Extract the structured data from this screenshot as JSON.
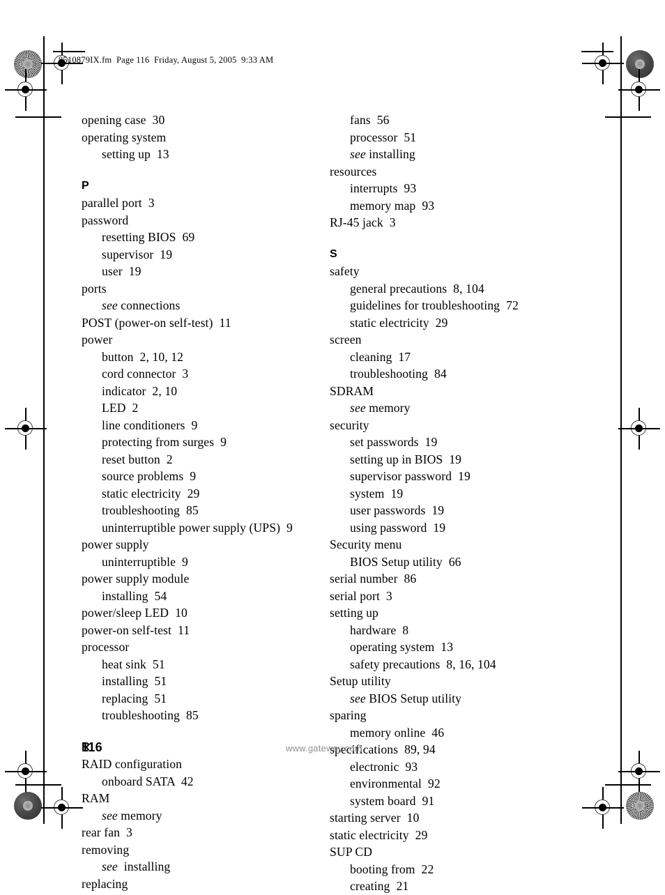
{
  "header": {
    "slug": "8510879IX.fm  Page 116  Friday, August 5, 2005  9:33 AM"
  },
  "footer": {
    "page_number": "116",
    "website": "www.gateway.com"
  },
  "index": {
    "left_column": [
      {
        "level": 0,
        "text": "opening case  30"
      },
      {
        "level": 0,
        "text": "operating system"
      },
      {
        "level": 1,
        "text": "setting up  13"
      },
      {
        "level": 0,
        "type": "letter",
        "text": "P",
        "space_before": true
      },
      {
        "level": 0,
        "text": "parallel port  3"
      },
      {
        "level": 0,
        "text": "password"
      },
      {
        "level": 1,
        "text": "resetting BIOS  69"
      },
      {
        "level": 1,
        "text": "supervisor  19"
      },
      {
        "level": 1,
        "text": "user  19"
      },
      {
        "level": 0,
        "text": "ports"
      },
      {
        "level": 2,
        "see": "see",
        "text": " connections"
      },
      {
        "level": 0,
        "text": "POST (power-on self-test)  11"
      },
      {
        "level": 0,
        "text": "power"
      },
      {
        "level": 1,
        "text": "button  2, 10, 12"
      },
      {
        "level": 1,
        "text": "cord connector  3"
      },
      {
        "level": 1,
        "text": "indicator  2, 10"
      },
      {
        "level": 1,
        "text": "LED  2"
      },
      {
        "level": 1,
        "text": "line conditioners  9"
      },
      {
        "level": 1,
        "text": "protecting from surges  9"
      },
      {
        "level": 1,
        "text": "reset button  2"
      },
      {
        "level": 1,
        "text": "source problems  9"
      },
      {
        "level": 1,
        "text": "static electricity  29"
      },
      {
        "level": 1,
        "text": "troubleshooting  85"
      },
      {
        "level": 1,
        "text": "uninterruptible power supply (UPS)  9"
      },
      {
        "level": 0,
        "text": "power supply"
      },
      {
        "level": 1,
        "text": "uninterruptible  9"
      },
      {
        "level": 0,
        "text": "power supply module"
      },
      {
        "level": 1,
        "text": "installing  54"
      },
      {
        "level": 0,
        "text": "power/sleep LED  10"
      },
      {
        "level": 0,
        "text": "power-on self-test  11"
      },
      {
        "level": 0,
        "text": "processor"
      },
      {
        "level": 1,
        "text": "heat sink  51"
      },
      {
        "level": 1,
        "text": "installing  51"
      },
      {
        "level": 1,
        "text": "replacing  51"
      },
      {
        "level": 1,
        "text": "troubleshooting  85"
      },
      {
        "level": 0,
        "type": "letter",
        "text": "R",
        "space_before": true
      },
      {
        "level": 0,
        "text": "RAID configuration"
      },
      {
        "level": 1,
        "text": "onboard SATA  42"
      },
      {
        "level": 0,
        "text": "RAM"
      },
      {
        "level": 2,
        "see": "see",
        "text": " memory"
      },
      {
        "level": 0,
        "text": "rear fan  3"
      },
      {
        "level": 0,
        "text": "removing"
      },
      {
        "level": 2,
        "see": "see",
        "text": "  installing"
      },
      {
        "level": 0,
        "text": "replacing"
      }
    ],
    "right_column": [
      {
        "level": 1,
        "text": "fans  56"
      },
      {
        "level": 1,
        "text": "processor  51"
      },
      {
        "level": 2,
        "see": "see",
        "text": " installing"
      },
      {
        "level": 0,
        "text": "resources"
      },
      {
        "level": 1,
        "text": "interrupts  93"
      },
      {
        "level": 1,
        "text": "memory map  93"
      },
      {
        "level": 0,
        "text": "RJ-45 jack  3"
      },
      {
        "level": 0,
        "type": "letter",
        "text": "S",
        "space_before": true
      },
      {
        "level": 0,
        "text": "safety"
      },
      {
        "level": 1,
        "text": "general precautions  8, 104"
      },
      {
        "level": 1,
        "text": "guidelines for troubleshooting  72"
      },
      {
        "level": 1,
        "text": "static electricity  29"
      },
      {
        "level": 0,
        "text": "screen"
      },
      {
        "level": 1,
        "text": "cleaning  17"
      },
      {
        "level": 1,
        "text": "troubleshooting  84"
      },
      {
        "level": 0,
        "text": "SDRAM"
      },
      {
        "level": 2,
        "see": "see",
        "text": " memory"
      },
      {
        "level": 0,
        "text": "security"
      },
      {
        "level": 1,
        "text": "set passwords  19"
      },
      {
        "level": 1,
        "text": "setting up in BIOS  19"
      },
      {
        "level": 1,
        "text": "supervisor password  19"
      },
      {
        "level": 1,
        "text": "system  19"
      },
      {
        "level": 1,
        "text": "user passwords  19"
      },
      {
        "level": 1,
        "text": "using password  19"
      },
      {
        "level": 0,
        "text": "Security menu"
      },
      {
        "level": 1,
        "text": "BIOS Setup utility  66"
      },
      {
        "level": 0,
        "text": "serial number  86"
      },
      {
        "level": 0,
        "text": "serial port  3"
      },
      {
        "level": 0,
        "text": "setting up"
      },
      {
        "level": 1,
        "text": "hardware  8"
      },
      {
        "level": 1,
        "text": "operating system  13"
      },
      {
        "level": 1,
        "text": "safety precautions  8, 16, 104"
      },
      {
        "level": 0,
        "text": "Setup utility"
      },
      {
        "level": 2,
        "see": "see",
        "text": " BIOS Setup utility"
      },
      {
        "level": 0,
        "text": "sparing"
      },
      {
        "level": 1,
        "text": "memory online  46"
      },
      {
        "level": 0,
        "text": "specifications  89, 94"
      },
      {
        "level": 1,
        "text": "electronic  93"
      },
      {
        "level": 1,
        "text": "environmental  92"
      },
      {
        "level": 1,
        "text": "system board  91"
      },
      {
        "level": 0,
        "text": "starting server  10"
      },
      {
        "level": 0,
        "text": "static electricity  29"
      },
      {
        "level": 0,
        "text": "SUP CD"
      },
      {
        "level": 1,
        "text": "booting from  22"
      },
      {
        "level": 1,
        "text": "creating  21"
      }
    ]
  },
  "marks": {
    "registration_target": "registration-target",
    "density_solid": "density-patch-solid",
    "density_star": "density-patch-starburst"
  }
}
